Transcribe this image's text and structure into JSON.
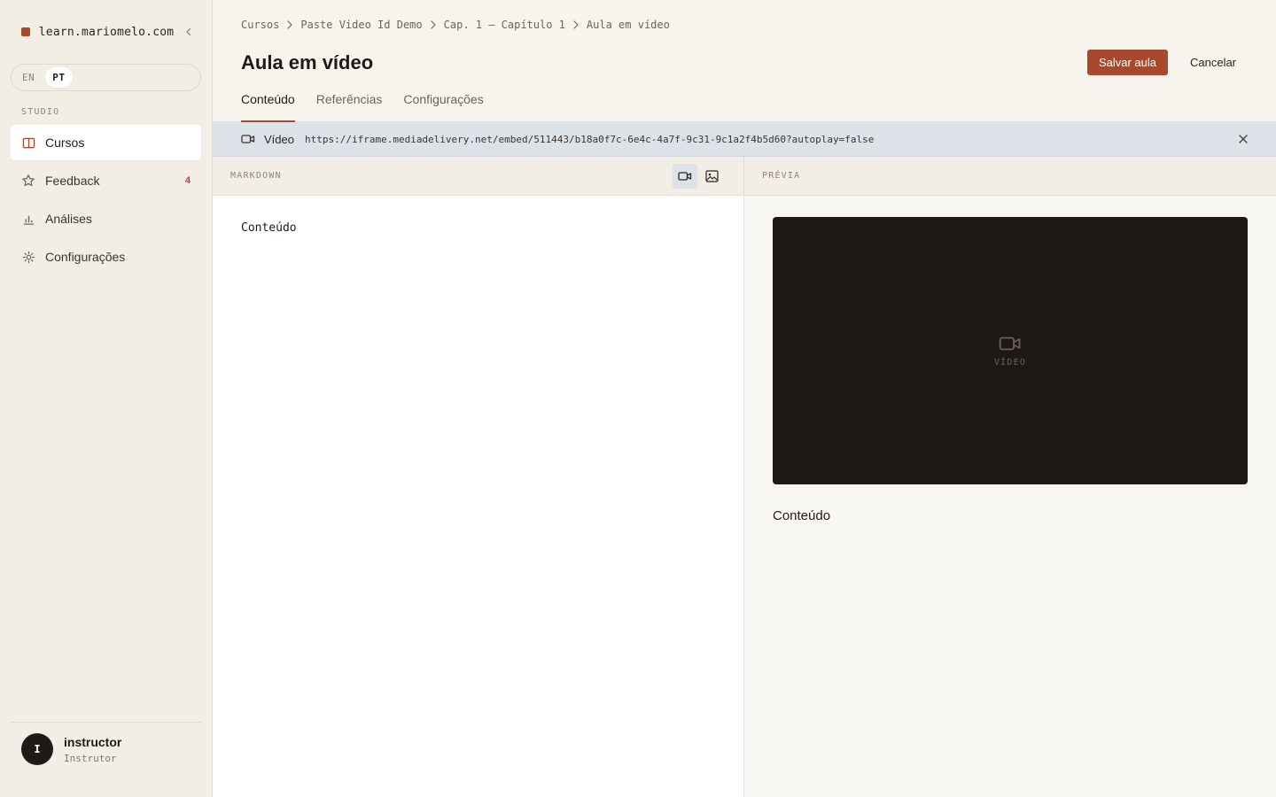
{
  "sidebar": {
    "brand": "learn.mariomelo.com",
    "languages": [
      "EN",
      "PT"
    ],
    "active_language": "PT",
    "section_label": "STUDIO",
    "items": [
      {
        "label": "Cursos",
        "icon": "book-icon",
        "active": true
      },
      {
        "label": "Feedback",
        "icon": "star-icon",
        "badge": "4"
      },
      {
        "label": "Análises",
        "icon": "bar-chart-icon"
      },
      {
        "label": "Configurações",
        "icon": "gear-icon"
      }
    ],
    "user": {
      "initial": "I",
      "name": "instructor",
      "role": "Instrutor"
    }
  },
  "header": {
    "breadcrumb": [
      "Cursos",
      "Paste Video Id Demo",
      "Cap. 1 — Capítulo 1",
      "Aula em vídeo"
    ],
    "title": "Aula em vídeo",
    "save_label": "Salvar aula",
    "cancel_label": "Cancelar",
    "tabs": [
      "Conteúdo",
      "Referências",
      "Configurações"
    ],
    "active_tab": "Conteúdo"
  },
  "video_bar": {
    "label": "Vídeo",
    "url": "https://iframe.mediadelivery.net/embed/511443/b18a0f7c-6e4c-4a7f-9c31-9c1a2f4b5d60?autoplay=false"
  },
  "editor": {
    "label": "MARKDOWN",
    "content": "Conteúdo"
  },
  "preview": {
    "label": "PRÉVIA",
    "video_placeholder": "VÍDEO",
    "content": "Conteúdo"
  },
  "colors": {
    "accent": "#a8492d",
    "background": "#f7f4ee",
    "sidebar": "#f2eee6",
    "video_bar": "#dde2e8",
    "video_frame": "#1e1916"
  }
}
